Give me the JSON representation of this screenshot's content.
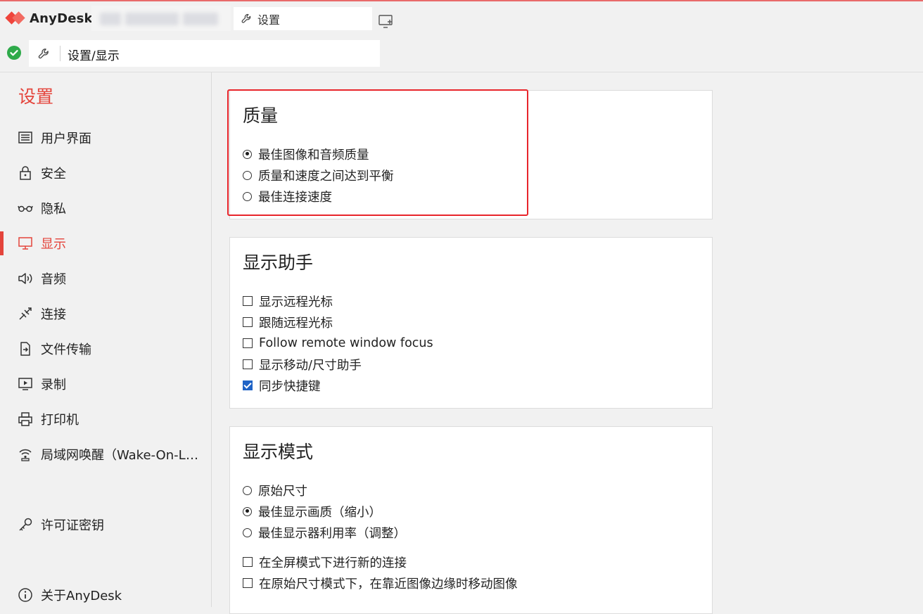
{
  "app": {
    "name": "AnyDesk"
  },
  "tabs": {
    "active_label": "设置"
  },
  "address": {
    "path": "设置/显示"
  },
  "sidebar": {
    "title": "设置",
    "items": [
      {
        "label": "用户界面",
        "icon": "monitor-list-icon"
      },
      {
        "label": "安全",
        "icon": "lock-icon"
      },
      {
        "label": "隐私",
        "icon": "glasses-icon"
      },
      {
        "label": "显示",
        "icon": "display-icon",
        "active": true
      },
      {
        "label": "音频",
        "icon": "speaker-icon"
      },
      {
        "label": "连接",
        "icon": "connection-icon"
      },
      {
        "label": "文件传输",
        "icon": "file-transfer-icon"
      },
      {
        "label": "录制",
        "icon": "recording-icon"
      },
      {
        "label": "打印机",
        "icon": "printer-icon"
      },
      {
        "label": "局域网唤醒（Wake-On-LAN）",
        "icon": "wifi-icon"
      },
      {
        "label": "许可证密钥",
        "icon": "key-icon"
      },
      {
        "label": "关于AnyDesk",
        "icon": "info-icon"
      }
    ]
  },
  "quality": {
    "title": "质量",
    "options": [
      "最佳图像和音频质量",
      "质量和速度之间达到平衡",
      "最佳连接速度"
    ],
    "selected": 0
  },
  "display_helper": {
    "title": "显示助手",
    "options": [
      {
        "label": "显示远程光标",
        "checked": false
      },
      {
        "label": "跟随远程光标",
        "checked": false
      },
      {
        "label": "Follow remote window focus",
        "checked": false
      },
      {
        "label": "显示移动/尺寸助手",
        "checked": false
      },
      {
        "label": "同步快捷键",
        "checked": true
      }
    ]
  },
  "display_mode": {
    "title": "显示模式",
    "radios": [
      "原始尺寸",
      "最佳显示画质（缩小）",
      "最佳显示器利用率（调整）"
    ],
    "selected": 1,
    "checks": [
      {
        "label": "在全屏模式下进行新的连接",
        "checked": false
      },
      {
        "label": "在原始尺寸模式下，在靠近图像边缘时移动图像",
        "checked": false
      }
    ]
  },
  "colors": {
    "accent": "#e4443b",
    "check": "#1f63c6",
    "highlight": "#e8252b",
    "ok": "#2eaa4a"
  }
}
